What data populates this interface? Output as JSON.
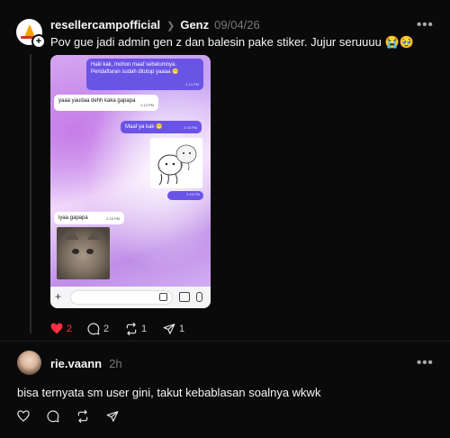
{
  "post": {
    "username": "resellercampofficial",
    "topic": "Genz",
    "date": "09/04/26",
    "text": "Pov gue jadi admin gen z dan balesin pake stiker. Jujur seruuuu 😭🥹",
    "more_label": "•••",
    "likes": "2",
    "comments": "2",
    "reposts": "1",
    "shares": "1",
    "liked_color": "#ff3040"
  },
  "screenshot": {
    "msg1": "Haiii kak, mohon maaf sebelumnya. Pendaftaran sudah ditutup yaaaa 😁",
    "msg1_time": "2.13 PM",
    "msg2": "yaaa yaudaa dehh kaka gapapa",
    "msg2_time": "2.14 PM",
    "msg3": "Maaf ya kak 😁",
    "msg3_time": "2.15 PM",
    "sticker_time": "2.15 PM",
    "msg4": "iyaa gapapa",
    "msg4_time": "2.15 PM"
  },
  "reply": {
    "username": "rie.vaann",
    "time": "2h",
    "text": "bisa ternyata sm user gini, takut kebablasan soalnya wkwk",
    "more_label": "•••"
  }
}
